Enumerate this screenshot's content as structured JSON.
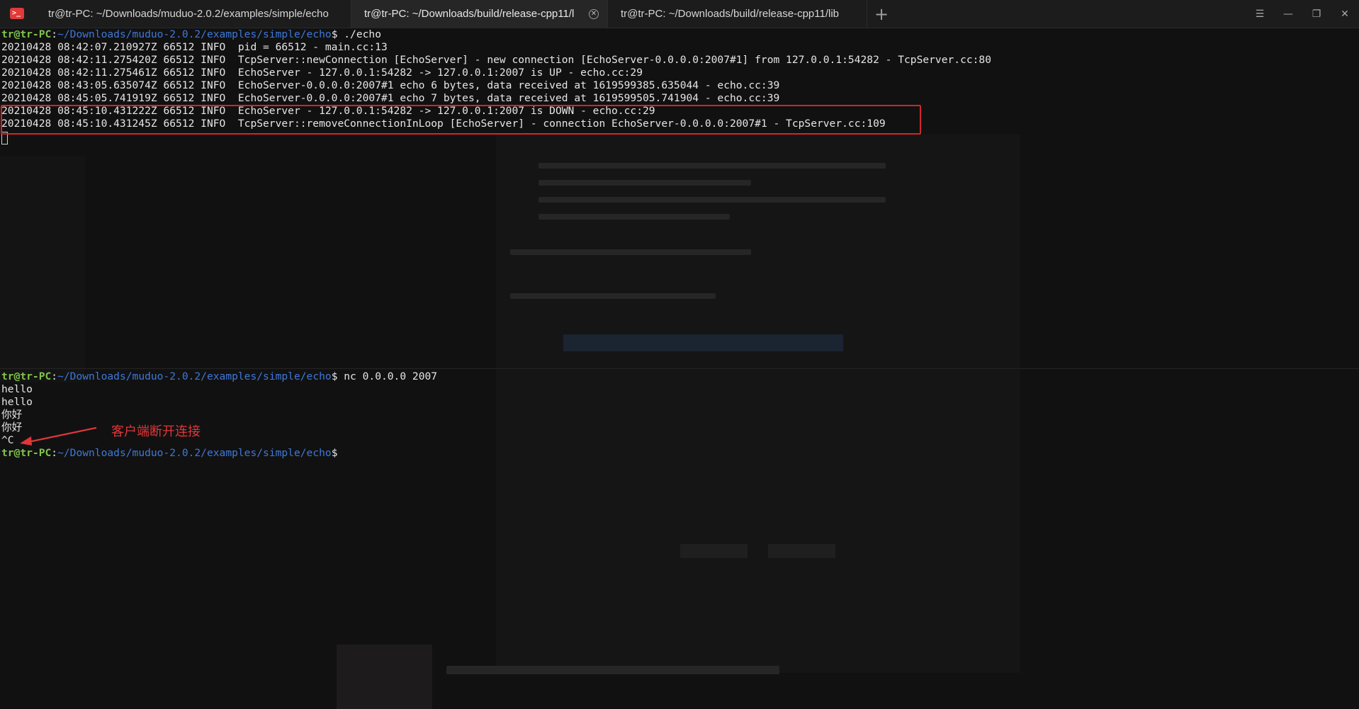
{
  "window": {
    "tabs": [
      {
        "label": "tr@tr-PC: ~/Downloads/muduo-2.0.2/examples/simple/echo",
        "active": false
      },
      {
        "label": "tr@tr-PC: ~/Downloads/build/release-cpp11/l",
        "active": true,
        "close_icon": "close-circle-icon"
      },
      {
        "label": "tr@tr-PC: ~/Downloads/build/release-cpp11/lib",
        "active": false
      }
    ],
    "new_tab_glyph": "+",
    "controls": {
      "menu": "☰",
      "minimize": "—",
      "maximize": "❐",
      "close": "✕"
    }
  },
  "top_pane": {
    "prompt": {
      "user": "tr@tr-PC",
      "colon": ":",
      "path": "~/Downloads/muduo-2.0.2/examples/simple/echo",
      "dollar": "$",
      "command": " ./echo"
    },
    "log_lines": [
      "20210428 08:42:07.210927Z 66512 INFO  pid = 66512 - main.cc:13",
      "20210428 08:42:11.275420Z 66512 INFO  TcpServer::newConnection [EchoServer] - new connection [EchoServer-0.0.0.0:2007#1] from 127.0.0.1:54282 - TcpServer.cc:80",
      "20210428 08:42:11.275461Z 66512 INFO  EchoServer - 127.0.0.1:54282 -> 127.0.0.1:2007 is UP - echo.cc:29",
      "20210428 08:43:05.635074Z 66512 INFO  EchoServer-0.0.0.0:2007#1 echo 6 bytes, data received at 1619599385.635044 - echo.cc:39",
      "20210428 08:45:05.741919Z 66512 INFO  EchoServer-0.0.0.0:2007#1 echo 7 bytes, data received at 1619599505.741904 - echo.cc:39",
      "20210428 08:45:10.431222Z 66512 INFO  EchoServer - 127.0.0.1:54282 -> 127.0.0.1:2007 is DOWN - echo.cc:29",
      "20210428 08:45:10.431245Z 66512 INFO  TcpServer::removeConnectionInLoop [EchoServer] - connection EchoServer-0.0.0.0:2007#1 - TcpServer.cc:109"
    ]
  },
  "bottom_pane": {
    "prompt": {
      "user": "tr@tr-PC",
      "colon": ":",
      "path": "~/Downloads/muduo-2.0.2/examples/simple/echo",
      "dollar": "$",
      "command": " nc 0.0.0.0 2007"
    },
    "output_lines": [
      "hello",
      "hello",
      "你好",
      "你好",
      "^C"
    ],
    "prompt2": {
      "user": "tr@tr-PC",
      "colon": ":",
      "path": "~/Downloads/muduo-2.0.2/examples/simple/echo",
      "dollar": "$"
    },
    "annotation": "客户端断开连接"
  },
  "colors": {
    "prompt_user": "#7ec34a",
    "prompt_path": "#3f78d8",
    "highlight_border": "#d4242a",
    "annotation": "#e0363a"
  }
}
